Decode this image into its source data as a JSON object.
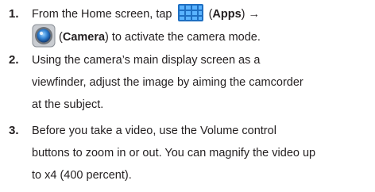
{
  "steps": [
    {
      "number": "1.",
      "line1": {
        "text_a": "From the Home screen, tap",
        "icon": "apps-grid-icon",
        "paren_open": "(",
        "bold": "Apps",
        "paren_close": ")",
        "arrow": "→"
      },
      "line2": {
        "icon": "camera-icon",
        "paren_open": "(",
        "bold": "Camera",
        "text_b": ") to activate the camera mode."
      }
    },
    {
      "number": "2.",
      "lines": [
        "Using the camera’s main display screen as a",
        "viewfinder, adjust the image by aiming the camcorder",
        "at the subject."
      ]
    },
    {
      "number": "3.",
      "lines": [
        "Before you take a video, use the Volume control",
        "buttons to zoom in or out. You can magnify the video up",
        "to x4 (400 percent)."
      ]
    }
  ],
  "colors": {
    "text": "#231f20",
    "apps_icon": "#2a8de3",
    "camera_ring": "#8a8f96"
  }
}
